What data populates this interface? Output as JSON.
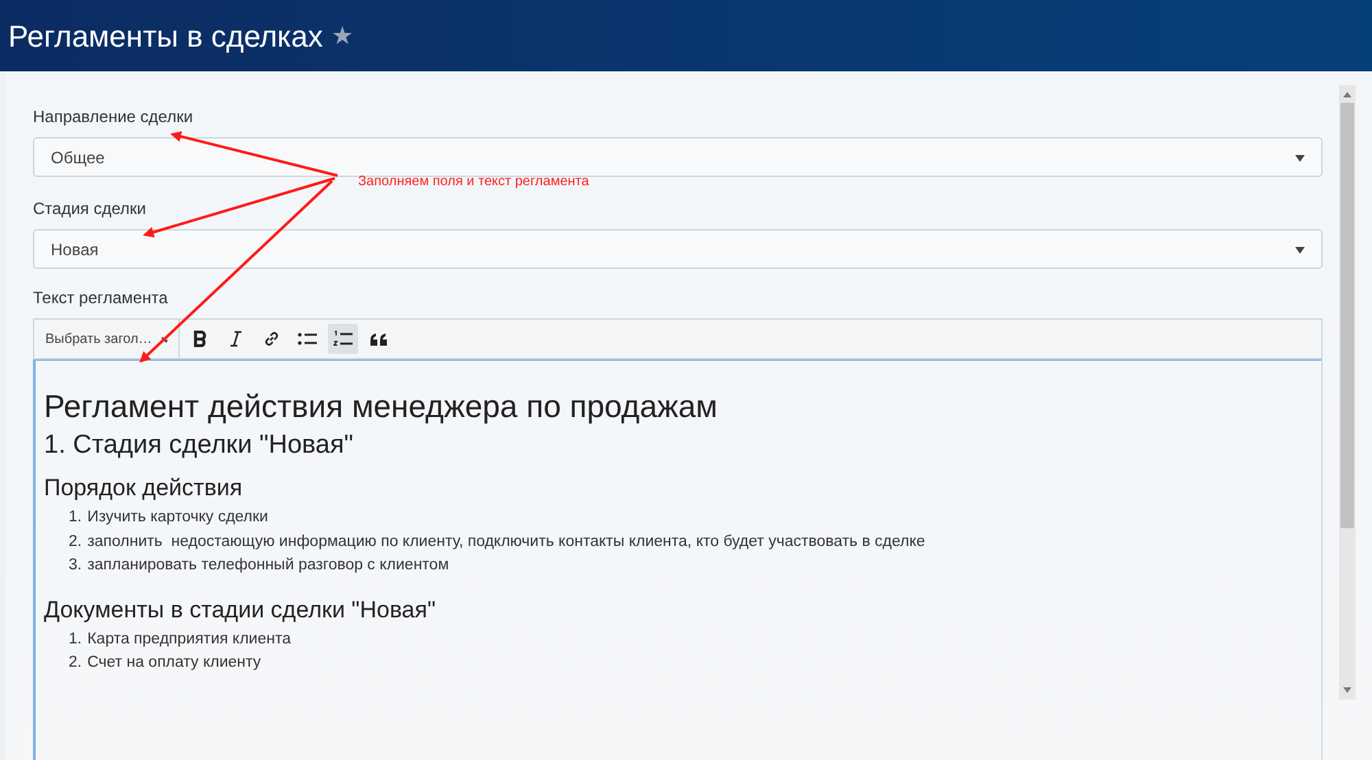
{
  "header": {
    "title": "Регламенты в сделках",
    "star": "★"
  },
  "fields": [
    {
      "label": "Направление сделки",
      "value": "Общее"
    },
    {
      "label": "Стадия сделки",
      "value": "Новая"
    }
  ],
  "editor": {
    "label": "Текст регламента",
    "toolbar": {
      "heading_select": "Выбрать загол…",
      "buttons": [
        {
          "kind": "bold",
          "selected": false
        },
        {
          "kind": "italic",
          "selected": false
        },
        {
          "kind": "link",
          "selected": false
        },
        {
          "kind": "bullets",
          "selected": false
        },
        {
          "kind": "numbered",
          "selected": true
        },
        {
          "kind": "quote",
          "selected": false
        }
      ]
    },
    "content": [
      {
        "kind": "h1",
        "text": "Регламент действия менеджера по продажам"
      },
      {
        "kind": "h2",
        "text": "1. Стадия сделки \"Новая\""
      },
      {
        "kind": "h3",
        "text": "Порядок действия"
      },
      {
        "kind": "ol",
        "items": [
          {
            "number": "1.",
            "text": "Изучить карточку сделки"
          },
          {
            "number": "2.",
            "text": "заполнить  недостающую информацию по клиенту, подключить контакты клиента, кто будет участвовать в сделке"
          },
          {
            "number": "3.",
            "text": "запланировать телефонный разговор с клиентом"
          }
        ]
      },
      {
        "kind": "h3",
        "text": "Документы в стадии сделки \"Новая\""
      },
      {
        "kind": "ol",
        "items": [
          {
            "number": "1.",
            "text": "Карта предприятия клиента"
          },
          {
            "number": "2.",
            "text": "Счет на оплату клиенту"
          }
        ]
      }
    ]
  },
  "annotation": {
    "text": "Заполняем поля и текст регламента"
  }
}
